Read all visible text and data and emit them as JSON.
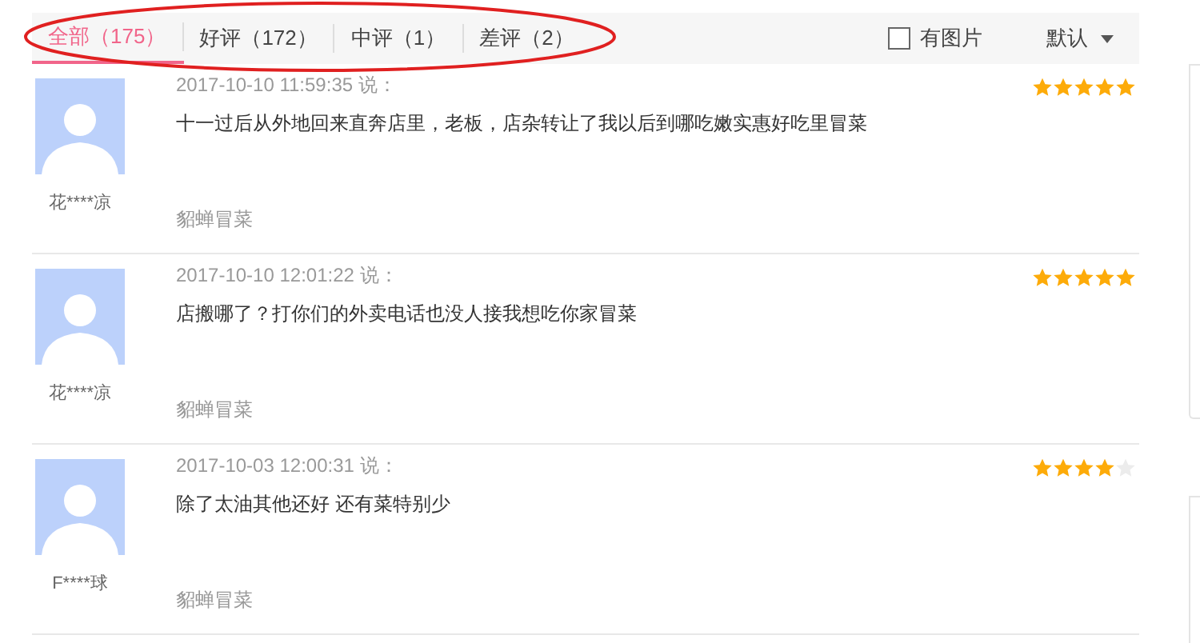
{
  "tabs": [
    {
      "label": "全部（175）",
      "selected": true
    },
    {
      "label": "好评（172）",
      "selected": false
    },
    {
      "label": "中评（1）",
      "selected": false
    },
    {
      "label": "差评（2）",
      "selected": false
    }
  ],
  "photo_filter": {
    "label": "有图片",
    "checked": false
  },
  "sort": {
    "label": "默认"
  },
  "reviews": [
    {
      "user": "花****凉",
      "time": "2017-10-10 11:59:35 说：",
      "text": "十一过后从外地回来直奔店里，老板，店杂转让了我以后到哪吃嫩实惠好吃里冒菜",
      "shop": "貂蝉冒菜",
      "stars": 5
    },
    {
      "user": "花****凉",
      "time": "2017-10-10 12:01:22 说：",
      "text": "店搬哪了？打你们的外卖电话也没人接我想吃你家冒菜",
      "shop": "貂蝉冒菜",
      "stars": 5
    },
    {
      "user": "F****球",
      "time": "2017-10-03 12:00:31 说：",
      "text": "除了太油其他还好  还有菜特别少",
      "shop": "貂蝉冒菜",
      "stars": 4
    }
  ]
}
